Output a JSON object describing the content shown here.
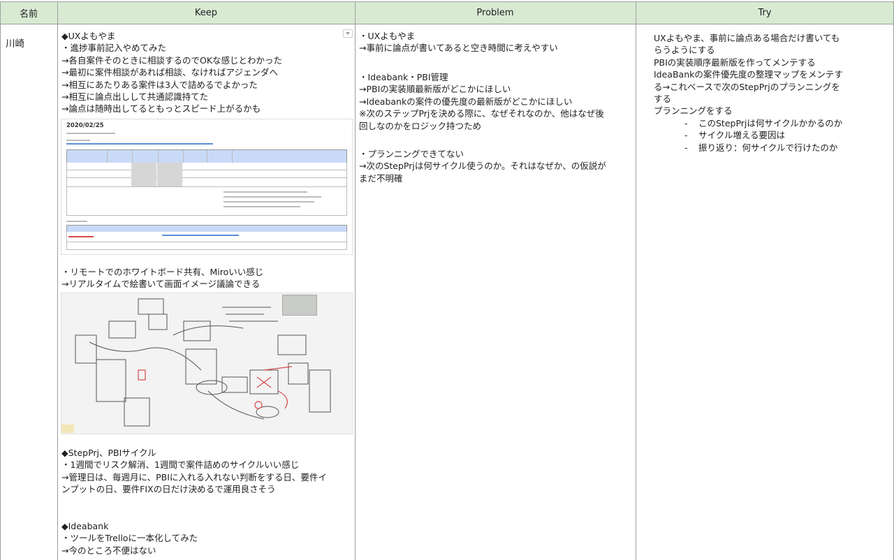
{
  "header": {
    "name": "名前",
    "keep": "Keep",
    "problem": "Problem",
    "try": "Try"
  },
  "row": {
    "name": "川崎",
    "keep": {
      "lines_a": [
        "◆UXよもやま",
        "・進捗事前記入やめてみた",
        "→各自案件そのときに相談するのでOKな感じとわかった",
        "→最初に案件相談があれば相談、なければアジェンダへ",
        "→相互にあたりある案件は3人で詰めるでよかった",
        "→相互に論点出しして共通認識持てた",
        "→論点は随時出してるともっとスピード上がるかも"
      ],
      "doc_thumb_date": "2020/02/25",
      "lines_b": [
        "・リモートでのホワイトボード共有、Miroいい感じ",
        "→リアルタイムで絵書いて画面イメージ議論できる"
      ],
      "lines_c": [
        "◆StepPrj、PBIサイクル",
        "・1週間でリスク解消、1週間で案件詰めのサイクルいい感じ",
        "→管理日は、毎週月に、PBIに入れる入れない判断をする日、要件イ",
        "ンプットの日、要件FIXの日だけ決めるで運用良さそう"
      ],
      "lines_d": [
        "◆Ideabank",
        "・ツールをTrelloに一本化してみた",
        "→今のところ不便はない"
      ]
    },
    "problem": {
      "lines_a": [
        "・UXよもやま",
        "→事前に論点が書いてあると空き時間に考えやすい"
      ],
      "lines_b": [
        "・Ideabank・PBI管理",
        "→PBIの実装順最新版がどこかにほしい",
        "→Ideabankの案件の優先度の最新版がどこかにほしい",
        "※次のステップPrjを決める際に、なぜそれなのか、他はなぜ後",
        "回しなのかをロジック持つため"
      ],
      "lines_c": [
        "・プランニングできてない",
        "→次のStepPrjは何サイクル使うのか。それはなぜか、の仮説が",
        "まだ不明確"
      ]
    },
    "try": {
      "items": [
        {
          "dash": "-",
          "lines": [
            "UXよもやま、事前に論点ある場合だけ書いても",
            "らうようにする"
          ]
        },
        {
          "dash": "-",
          "lines": [
            "PBIの実装順序最新版を作ってメンテする"
          ]
        },
        {
          "dash": "-",
          "lines": [
            "IdeaBankの案件優先度の整理マップをメンテす",
            "る→これベースで次のStepPrjのプランニングを",
            "する"
          ]
        },
        {
          "dash": "-",
          "lines": [
            "プランニングをする"
          ]
        }
      ],
      "subitems": [
        {
          "dash": "-",
          "text": "このStepPrjは何サイクルかかるのか"
        },
        {
          "dash": "-",
          "text": "サイクル増える要因は"
        },
        {
          "dash": "-",
          "text": "振り返り：何サイクルで行けたのか"
        }
      ]
    }
  },
  "colors": {
    "header_bg": "#d9ead3",
    "grid_line": "#9e9e9e",
    "doc_table_header": "#c9daf8"
  },
  "icons": {
    "dropdown": "chevron-down-icon"
  }
}
